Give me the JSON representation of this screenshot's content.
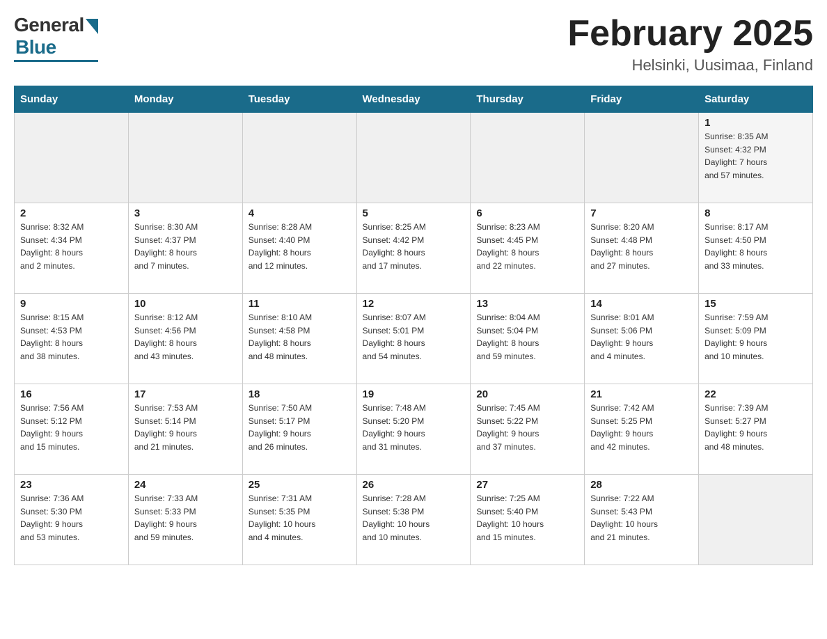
{
  "header": {
    "logo_general": "General",
    "logo_blue": "Blue",
    "title": "February 2025",
    "location": "Helsinki, Uusimaa, Finland"
  },
  "weekdays": [
    "Sunday",
    "Monday",
    "Tuesday",
    "Wednesday",
    "Thursday",
    "Friday",
    "Saturday"
  ],
  "weeks": [
    [
      {
        "day": "",
        "info": ""
      },
      {
        "day": "",
        "info": ""
      },
      {
        "day": "",
        "info": ""
      },
      {
        "day": "",
        "info": ""
      },
      {
        "day": "",
        "info": ""
      },
      {
        "day": "",
        "info": ""
      },
      {
        "day": "1",
        "info": "Sunrise: 8:35 AM\nSunset: 4:32 PM\nDaylight: 7 hours\nand 57 minutes."
      }
    ],
    [
      {
        "day": "2",
        "info": "Sunrise: 8:32 AM\nSunset: 4:34 PM\nDaylight: 8 hours\nand 2 minutes."
      },
      {
        "day": "3",
        "info": "Sunrise: 8:30 AM\nSunset: 4:37 PM\nDaylight: 8 hours\nand 7 minutes."
      },
      {
        "day": "4",
        "info": "Sunrise: 8:28 AM\nSunset: 4:40 PM\nDaylight: 8 hours\nand 12 minutes."
      },
      {
        "day": "5",
        "info": "Sunrise: 8:25 AM\nSunset: 4:42 PM\nDaylight: 8 hours\nand 17 minutes."
      },
      {
        "day": "6",
        "info": "Sunrise: 8:23 AM\nSunset: 4:45 PM\nDaylight: 8 hours\nand 22 minutes."
      },
      {
        "day": "7",
        "info": "Sunrise: 8:20 AM\nSunset: 4:48 PM\nDaylight: 8 hours\nand 27 minutes."
      },
      {
        "day": "8",
        "info": "Sunrise: 8:17 AM\nSunset: 4:50 PM\nDaylight: 8 hours\nand 33 minutes."
      }
    ],
    [
      {
        "day": "9",
        "info": "Sunrise: 8:15 AM\nSunset: 4:53 PM\nDaylight: 8 hours\nand 38 minutes."
      },
      {
        "day": "10",
        "info": "Sunrise: 8:12 AM\nSunset: 4:56 PM\nDaylight: 8 hours\nand 43 minutes."
      },
      {
        "day": "11",
        "info": "Sunrise: 8:10 AM\nSunset: 4:58 PM\nDaylight: 8 hours\nand 48 minutes."
      },
      {
        "day": "12",
        "info": "Sunrise: 8:07 AM\nSunset: 5:01 PM\nDaylight: 8 hours\nand 54 minutes."
      },
      {
        "day": "13",
        "info": "Sunrise: 8:04 AM\nSunset: 5:04 PM\nDaylight: 8 hours\nand 59 minutes."
      },
      {
        "day": "14",
        "info": "Sunrise: 8:01 AM\nSunset: 5:06 PM\nDaylight: 9 hours\nand 4 minutes."
      },
      {
        "day": "15",
        "info": "Sunrise: 7:59 AM\nSunset: 5:09 PM\nDaylight: 9 hours\nand 10 minutes."
      }
    ],
    [
      {
        "day": "16",
        "info": "Sunrise: 7:56 AM\nSunset: 5:12 PM\nDaylight: 9 hours\nand 15 minutes."
      },
      {
        "day": "17",
        "info": "Sunrise: 7:53 AM\nSunset: 5:14 PM\nDaylight: 9 hours\nand 21 minutes."
      },
      {
        "day": "18",
        "info": "Sunrise: 7:50 AM\nSunset: 5:17 PM\nDaylight: 9 hours\nand 26 minutes."
      },
      {
        "day": "19",
        "info": "Sunrise: 7:48 AM\nSunset: 5:20 PM\nDaylight: 9 hours\nand 31 minutes."
      },
      {
        "day": "20",
        "info": "Sunrise: 7:45 AM\nSunset: 5:22 PM\nDaylight: 9 hours\nand 37 minutes."
      },
      {
        "day": "21",
        "info": "Sunrise: 7:42 AM\nSunset: 5:25 PM\nDaylight: 9 hours\nand 42 minutes."
      },
      {
        "day": "22",
        "info": "Sunrise: 7:39 AM\nSunset: 5:27 PM\nDaylight: 9 hours\nand 48 minutes."
      }
    ],
    [
      {
        "day": "23",
        "info": "Sunrise: 7:36 AM\nSunset: 5:30 PM\nDaylight: 9 hours\nand 53 minutes."
      },
      {
        "day": "24",
        "info": "Sunrise: 7:33 AM\nSunset: 5:33 PM\nDaylight: 9 hours\nand 59 minutes."
      },
      {
        "day": "25",
        "info": "Sunrise: 7:31 AM\nSunset: 5:35 PM\nDaylight: 10 hours\nand 4 minutes."
      },
      {
        "day": "26",
        "info": "Sunrise: 7:28 AM\nSunset: 5:38 PM\nDaylight: 10 hours\nand 10 minutes."
      },
      {
        "day": "27",
        "info": "Sunrise: 7:25 AM\nSunset: 5:40 PM\nDaylight: 10 hours\nand 15 minutes."
      },
      {
        "day": "28",
        "info": "Sunrise: 7:22 AM\nSunset: 5:43 PM\nDaylight: 10 hours\nand 21 minutes."
      },
      {
        "day": "",
        "info": ""
      }
    ]
  ]
}
